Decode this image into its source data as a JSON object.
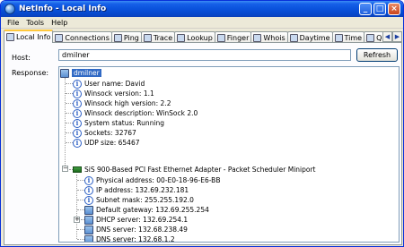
{
  "window": {
    "title": "NetInfo - Local Info",
    "minimize": "_",
    "maximize": "□",
    "close": "×"
  },
  "menu": [
    "File",
    "Tools",
    "Help"
  ],
  "tabs": [
    {
      "label": "Local Info",
      "active": true
    },
    {
      "label": "Connections"
    },
    {
      "label": "Ping"
    },
    {
      "label": "Trace"
    },
    {
      "label": "Lookup"
    },
    {
      "label": "Finger"
    },
    {
      "label": "Whois"
    },
    {
      "label": "Daytime"
    },
    {
      "label": "Time"
    },
    {
      "label": "Quote"
    }
  ],
  "tab_scroll": {
    "left": "◀",
    "right": "▶"
  },
  "host": {
    "label": "Host:",
    "value": "dmilner"
  },
  "refresh_label": "Refresh",
  "response_label": "Response:",
  "tree": {
    "root": "dmilner",
    "host_info": [
      "User name: David",
      "Winsock version: 1.1",
      "Winsock high version: 2.2",
      "Winsock description: WinSock 2.0",
      "System status: Running",
      "Sockets: 32767",
      "UDP size: 65467"
    ],
    "adapter": "SiS 900-Based PCI Fast Ethernet Adapter - Packet Scheduler Miniport",
    "adapter_info": [
      "Physical address: 00-E0-18-96-E6-BB",
      "IP address: 132.69.232.181",
      "Subnet mask: 255.255.192.0",
      "Default gateway: 132.69.255.254",
      "DHCP server: 132.69.254.1",
      "DNS server: 132.68.238.49",
      "DNS server: 132.68.1.2"
    ],
    "expand_minus": "−",
    "expand_plus": "+"
  }
}
